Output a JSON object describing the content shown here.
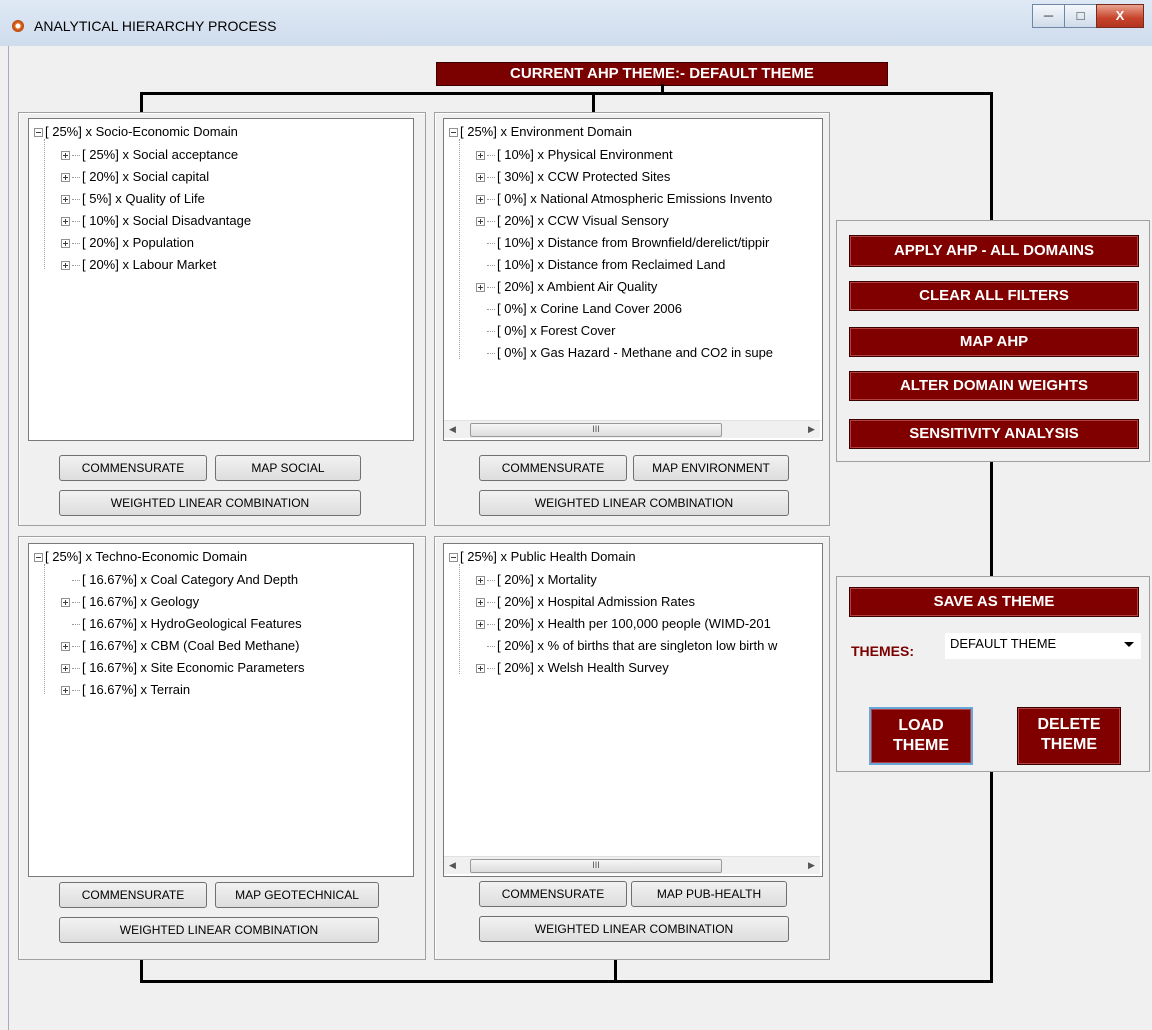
{
  "window": {
    "title": "ANALYTICAL HIERARCHY PROCESS"
  },
  "banner": {
    "text": "CURRENT AHP THEME:- DEFAULT THEME"
  },
  "domains": {
    "social": {
      "root": "[ 25%] x Socio-Economic Domain",
      "items": [
        "[ 25%] x Social acceptance",
        "[ 20%] x Social capital",
        "[ 5%] x Quality of Life",
        "[ 10%] x Social Disadvantage",
        "[ 20%] x Population",
        "[ 20%] x Labour Market"
      ],
      "btn_commensurate": "COMMENSURATE",
      "btn_map": "MAP SOCIAL",
      "btn_wlc": "WEIGHTED LINEAR COMBINATION"
    },
    "environment": {
      "root": "[ 25%] x Environment Domain",
      "items": [
        "[ 10%] x Physical Environment",
        "[ 30%] x CCW Protected Sites",
        "[ 0%] x National Atmospheric Emissions Invento",
        "[ 20%] x CCW Visual Sensory",
        "[ 10%] x Distance from Brownfield/derelict/tippir",
        "[ 10%] x Distance from Reclaimed Land",
        "[ 20%] x Ambient Air Quality",
        "[ 0%] x Corine Land Cover 2006",
        "[ 0%] x Forest Cover",
        "[ 0%] x Gas Hazard - Methane and CO2 in supe"
      ],
      "scroll_thumb": "III",
      "btn_commensurate": "COMMENSURATE",
      "btn_map": "MAP ENVIRONMENT",
      "btn_wlc": "WEIGHTED LINEAR COMBINATION"
    },
    "techno": {
      "root": "[ 25%] x Techno-Economic Domain",
      "items": [
        "[ 16.67%] x Coal Category And Depth",
        "[ 16.67%] x Geology",
        "[ 16.67%] x HydroGeological Features",
        "[ 16.67%] x CBM (Coal Bed Methane)",
        "[ 16.67%] x Site Economic Parameters",
        "[ 16.67%] x Terrain"
      ],
      "btn_commensurate": "COMMENSURATE",
      "btn_map": "MAP GEOTECHNICAL",
      "btn_wlc": "WEIGHTED LINEAR COMBINATION"
    },
    "health": {
      "root": "[ 25%] x Public Health Domain",
      "items": [
        "[ 20%] x Mortality",
        "[ 20%] x Hospital Admission Rates",
        "[ 20%] x Health per 100,000 people (WIMD-201",
        "[ 20%] x % of births that are singleton low birth w",
        "[ 20%] x Welsh Health Survey"
      ],
      "scroll_thumb": "III",
      "btn_commensurate": "COMMENSURATE",
      "btn_map": "MAP PUB-HEALTH",
      "btn_wlc": "WEIGHTED LINEAR COMBINATION"
    }
  },
  "actions": {
    "apply_all": "APPLY AHP - ALL DOMAINS",
    "clear_filters": "CLEAR ALL FILTERS",
    "map_ahp": "MAP AHP",
    "alter_weights": "ALTER DOMAIN WEIGHTS",
    "sensitivity": "SENSITIVITY ANALYSIS"
  },
  "themes": {
    "save": "SAVE AS THEME",
    "label": "THEMES:",
    "selected": "DEFAULT THEME",
    "load_line1": "LOAD",
    "load_line2": "THEME",
    "delete_line1": "DELETE",
    "delete_line2": "THEME"
  },
  "colors": {
    "accent": "#800000",
    "banner": "#7b0000"
  }
}
